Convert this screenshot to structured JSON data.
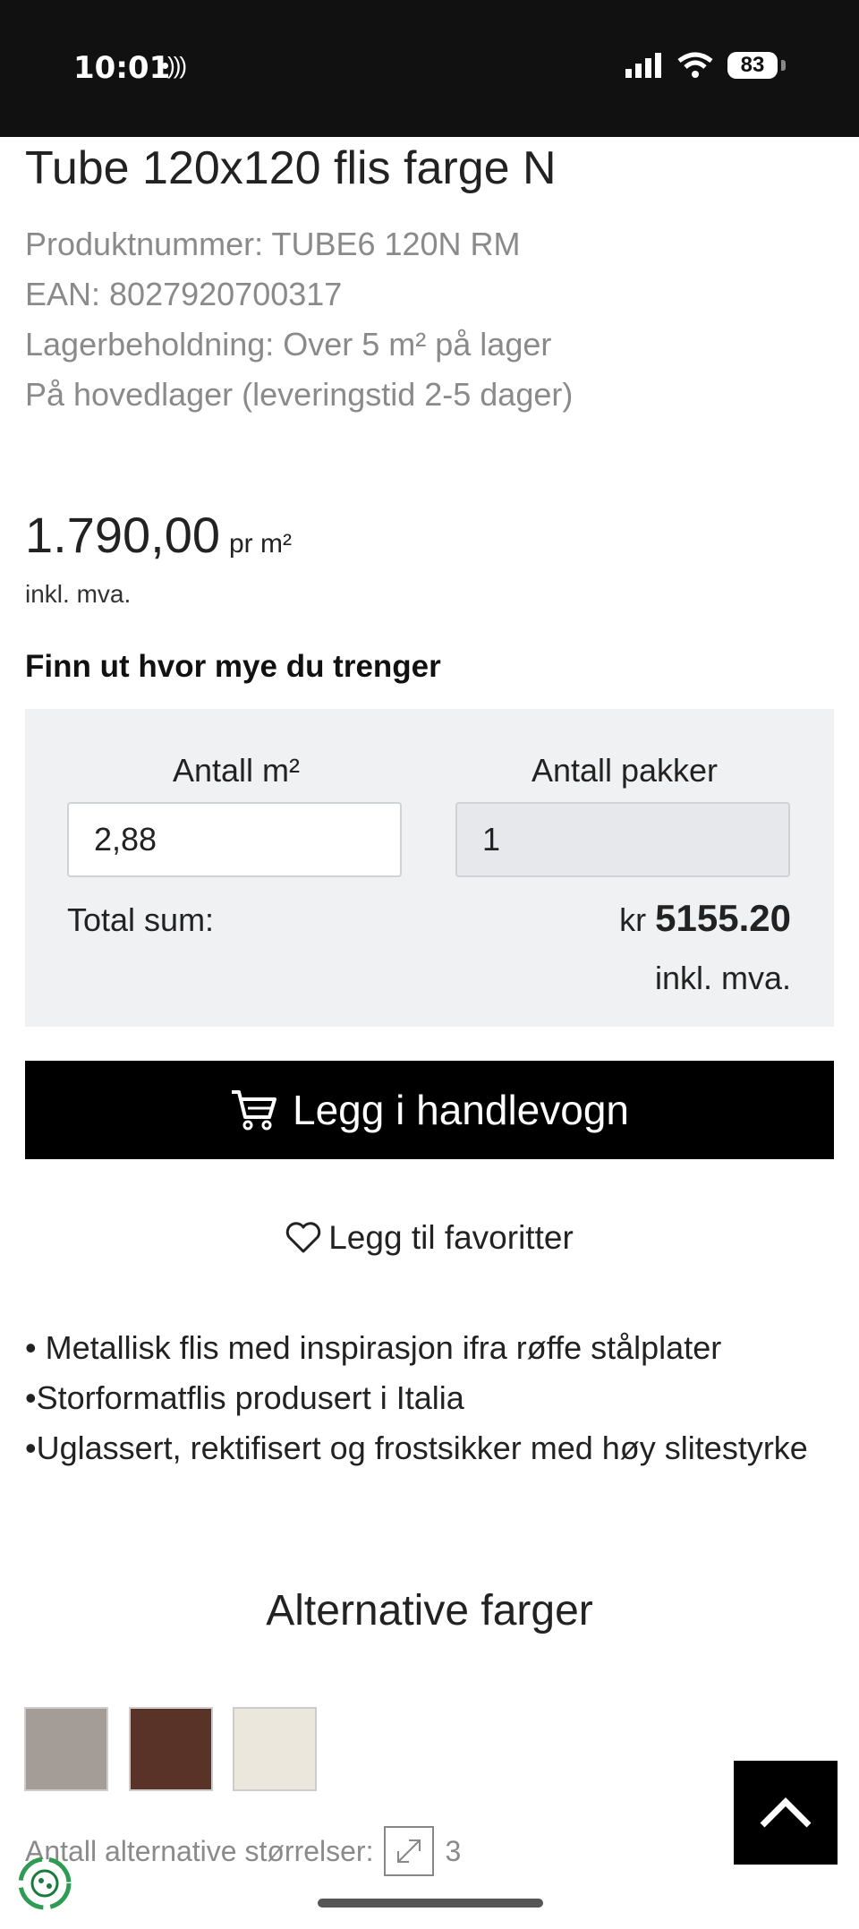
{
  "status_bar": {
    "time": "10:01",
    "battery": "83"
  },
  "product": {
    "title": "Tube 120x120 flis farge N",
    "meta": [
      "Produktnummer: TUBE6 120N RM",
      "EAN: 8027920700317",
      "Lagerbeholdning: Over 5 m² på lager",
      "På hovedlager (leveringstid 2-5 dager)"
    ],
    "price": "1.790,00",
    "price_unit": "pr m²",
    "vat_note": "inkl. mva."
  },
  "calculator": {
    "heading": "Finn ut hvor mye du trenger",
    "area_label": "Antall m²",
    "area_value": "2,88",
    "packs_label": "Antall pakker",
    "packs_value": "1",
    "total_label": "Total sum:",
    "currency": "kr",
    "total_value": "5155.20",
    "total_vat": "inkl. mva."
  },
  "actions": {
    "cart_label": "Legg i handlevogn",
    "favorite_label": "Legg til favoritter"
  },
  "description": [
    "• Metallisk flis med inspirasjon ifra røffe stålplater",
    "•Storformatflis produsert i Italia",
    "•Uglassert, rektifisert og frostsikker med høy slitestyrke"
  ],
  "alternatives": {
    "title": "Alternative farger",
    "swatch_colors": [
      "#a49d97",
      "#5a3328",
      "#ebe7dc"
    ],
    "sizes_label": "Antall alternative størrelser:",
    "sizes_count": "3"
  },
  "icons": {
    "cart": "cart-icon",
    "favorite": "heart-icon",
    "expand": "expand-icon",
    "scroll_top": "chevron-up-icon",
    "eco": "recycle-badge-icon"
  }
}
